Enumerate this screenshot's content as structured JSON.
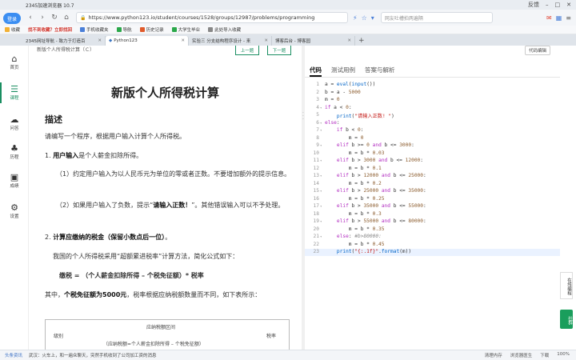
{
  "browser": {
    "title": "2345加速浏览器 10.7",
    "login": "登录",
    "window_right": "反馈",
    "url": "https://www.python123.io/student/courses/1528/groups/12987/problems/programming",
    "search_placeholder": "网友吐槽拍两遍隔",
    "bookmarks": [
      "收藏",
      "找不到收藏？立即找回",
      "手机收藏夹",
      "导航",
      "历史记录",
      "大学生毕业",
      "此处导入收藏"
    ],
    "tabs": [
      {
        "label": "2345网址导航 - 致力于打造百"
      },
      {
        "label": "Python123"
      },
      {
        "label": "实验三 分支结构程序设计 - 来"
      },
      {
        "label": "博客后台 - 博客园"
      }
    ]
  },
  "rail": [
    {
      "icon": "home-icon",
      "glyph": "⌂",
      "label": "首页"
    },
    {
      "icon": "course-icon",
      "glyph": "☰",
      "label": "课程"
    },
    {
      "icon": "qa-icon",
      "glyph": "☁",
      "label": "问答"
    },
    {
      "icon": "path-icon",
      "glyph": "♣",
      "label": "历程"
    },
    {
      "icon": "score-icon",
      "glyph": "▣",
      "label": "成绩"
    },
    {
      "icon": "settings-icon",
      "glyph": "⚙",
      "label": "设置"
    }
  ],
  "problem": {
    "head": "新版个人所得税计算（Ｃ）",
    "prev_label": "上一题",
    "next_label": "下一题",
    "title": "新版个人所得税计算",
    "section": "描述",
    "intro": "请编写一个程序，根据用户输入计算个人所得税。",
    "p1_prefix": "1. ",
    "p1_bold": "用户输入",
    "p1_rest": "是个人薪金扣除所得。",
    "p2": "（1）约定用户输入为以人民币元为单位的零或者正数。不要增加额外的提示信息。",
    "p3_a": "（2）如果用户输入了负数，提示“",
    "p3_bold": "请输入正数！",
    "p3_b": "”。其他错误输入可以不予处理。",
    "p4_prefix": "2. ",
    "p4_bold": "计算应缴纳的税金（保留小数点后一位）",
    "p4_rest": "。",
    "p5": "我国的个人所得税采用“超额累进税率”计算方法，简化公式如下：",
    "formula": "缴税 = （个人薪金扣除所得 – 个税免征额）* 税率",
    "p6_a": "其中，",
    "p6_bold": "个税免征额为5000元",
    "p6_b": "，税率根据应纳税额数量而不同，如下表所示：",
    "table_h1": "级别",
    "table_h2": "应纳税额区间",
    "table_h2_sub": "（应纳税额=个人薪金扣除所得 – 个税免征额）",
    "table_h3": "税率"
  },
  "code_pane": {
    "tabs": [
      "代码",
      "测试用例",
      "答案与解析"
    ],
    "lang": "代码编辑",
    "lines": [
      "a = eval(input())",
      "b = a - 5000",
      "m = 0",
      "if a < 0:",
      "    print(\"请输入正数! \")",
      "else:",
      "    if b < 0:",
      "        m = 0",
      "    elif b >= 0 and b <= 3000:",
      "        m = b * 0.03",
      "    elif b > 3000 and b <= 12000:",
      "        m = b * 0.1",
      "    elif b > 12000 and b <= 25000:",
      "        m = b * 0.2",
      "    elif b > 25000 and b <= 35000:",
      "        m = b * 0.25",
      "    elif b > 35000 and b <= 55000:",
      "        m = b * 0.3",
      "    elif b > 55000 and b <= 80000:",
      "        m = b * 0.35",
      "    else: #b>80000:",
      "        m = b * 0.45",
      "    print(\"{:.1f}\".format(m))"
    ],
    "folds": [
      4,
      6,
      7,
      9,
      11,
      13,
      15,
      17,
      19,
      21
    ]
  },
  "side": {
    "float_text": "在线编程",
    "green_text": "社群"
  },
  "status": {
    "left": "头条资讯",
    "ticker": "武汉：火车上，和一遍众聊天，突然手机收到了公司加工资的消息",
    "items": [
      "清理内存",
      "浏览器医生",
      "下载",
      "100%"
    ]
  }
}
